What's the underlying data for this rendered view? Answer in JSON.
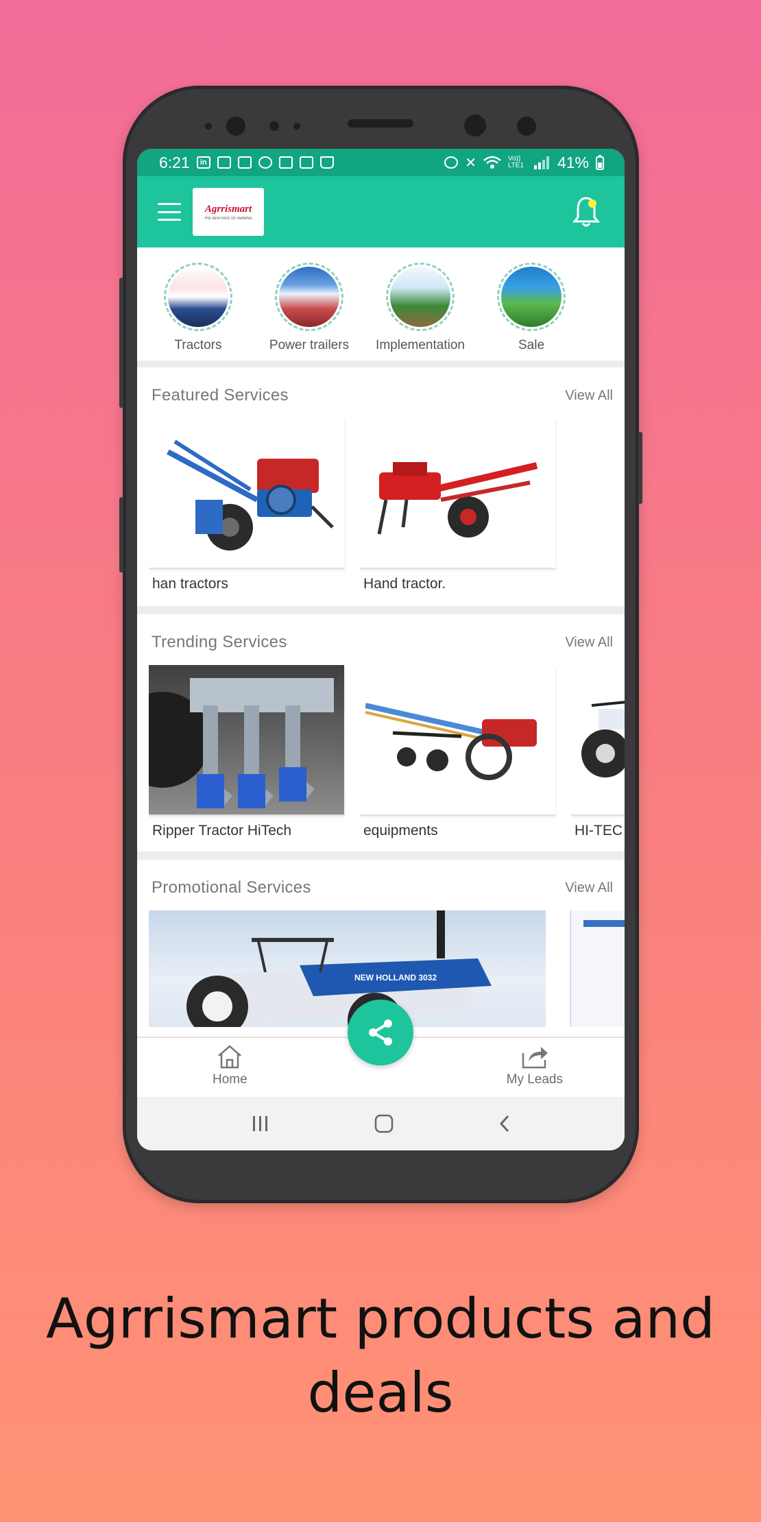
{
  "status_bar": {
    "time": "6:21",
    "battery": "41%",
    "signal_text": "Vo)) LTE1"
  },
  "app_bar": {
    "logo_text": "Agrrismart",
    "logo_tagline": "THE NEW FACE OF FARMING",
    "menu_icon": "hamburger-icon",
    "notification_icon": "bell-icon",
    "brand_color": "#1dc49c"
  },
  "categories": [
    {
      "label": "Tractors"
    },
    {
      "label": "Power trailers"
    },
    {
      "label": "Implementation"
    },
    {
      "label": "Sale"
    }
  ],
  "featured": {
    "title": "Featured Services",
    "view_all": "View All",
    "items": [
      {
        "label": "han tractors"
      },
      {
        "label": "Hand tractor."
      }
    ]
  },
  "trending": {
    "title": "Trending Services",
    "view_all": "View All",
    "items": [
      {
        "label": "Ripper Tractor HiTech"
      },
      {
        "label": "equipments"
      },
      {
        "label": "HI-TEC"
      }
    ]
  },
  "promotional": {
    "title": "Promotional Services",
    "view_all": "View All",
    "banner_text": "NEW HOLLAND 3032"
  },
  "bottom_nav": {
    "home": "Home",
    "my_leads": "My Leads",
    "fab_icon": "share-icon"
  },
  "caption": {
    "line1": "Agrrismart products and",
    "line2": "deals"
  }
}
